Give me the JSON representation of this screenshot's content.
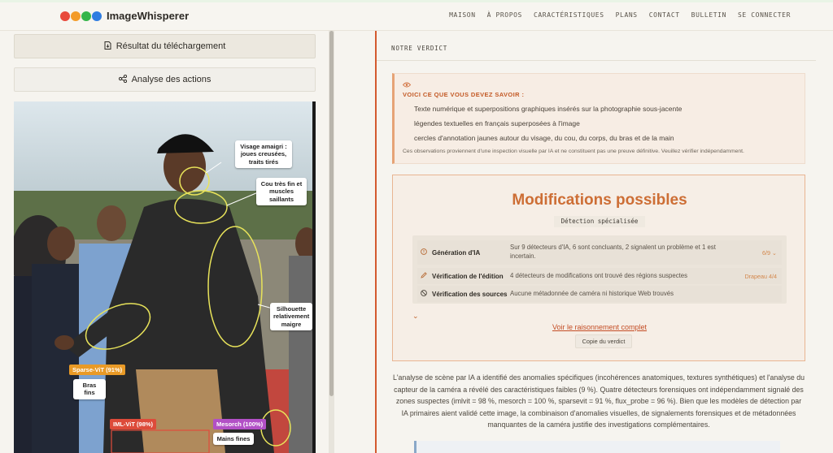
{
  "header": {
    "brand": "ImageWhisperer",
    "dots": [
      "#e84a3c",
      "#f39c2a",
      "#35b54a",
      "#2f7de1"
    ],
    "nav": [
      "MAISON",
      "À PROPOS",
      "CARACTÉRISTIQUES",
      "PLANS",
      "CONTACT",
      "BULLETIN",
      "SE CONNECTER"
    ]
  },
  "left": {
    "download_label": "Résultat du téléchargement",
    "actions_label": "Analyse des actions",
    "callouts": {
      "face": "Visage amaigri : joues creusées, traits tirés",
      "neck": "Cou très fin et muscles saillants",
      "silhouette": "Silhouette relativement maigre",
      "arms": "Bras fins",
      "hands": "Mains fines"
    },
    "tags": {
      "sparse": "Sparse-ViT (91%)",
      "iml": "IML-ViT (98%)",
      "mesorch": "Mesorch (100%)"
    }
  },
  "right": {
    "verdict_label": "NOTRE VERDICT",
    "know_title": "VOICI CE QUE VOUS DEVEZ SAVOIR :",
    "know_items": [
      "Texte numérique et superpositions graphiques insérés sur la photographie sous-jacente",
      "légendes textuelles en français superposées à l'image",
      "cercles d'annotation jaunes autour du visage, du cou, du corps, du bras et de la main"
    ],
    "know_note": "Ces observations proviennent d'une inspection visuelle par IA et ne constituent pas une preuve définitive. Veuillez vérifier indépendamment.",
    "mods_title": "Modifications possibles",
    "mods_sub": "Détection spécialisée",
    "detectors": [
      {
        "name": "Génération d'IA",
        "desc": "Sur 9 détecteurs d'IA, 6 sont concluants, 2 signalent un problème et 1 est incertain.",
        "status": "6/9 ⌄"
      },
      {
        "name": "Vérification de l'édition",
        "desc": "4 détecteurs de modifications ont trouvé des régions suspectes",
        "status": "Drapeau 4/4"
      },
      {
        "name": "Vérification des sources",
        "desc": "Aucune métadonnée de caméra ni historique Web trouvés",
        "status": ""
      }
    ],
    "reason_link": "Voir le raisonnement complet",
    "copy_label": "Copie du verdict",
    "analysis": "L'analyse de scène par IA a identifié des anomalies spécifiques (incohérences anatomiques, textures synthétiques) et l'analyse du capteur de la caméra a révélé des caractéristiques faibles (9 %). Quatre détecteurs forensiques ont indépendamment signalé des zones suspectes (imlvit = 98 %, mesorch = 100 %, sparsevit = 91 %, flux_probe = 96 %). Bien que les modèles de détection par IA primaires aient validé cette image, la combinaison d'anomalies visuelles, de signalements forensiques et de métadonnées manquantes de la caméra justifie des investigations complémentaires."
  }
}
